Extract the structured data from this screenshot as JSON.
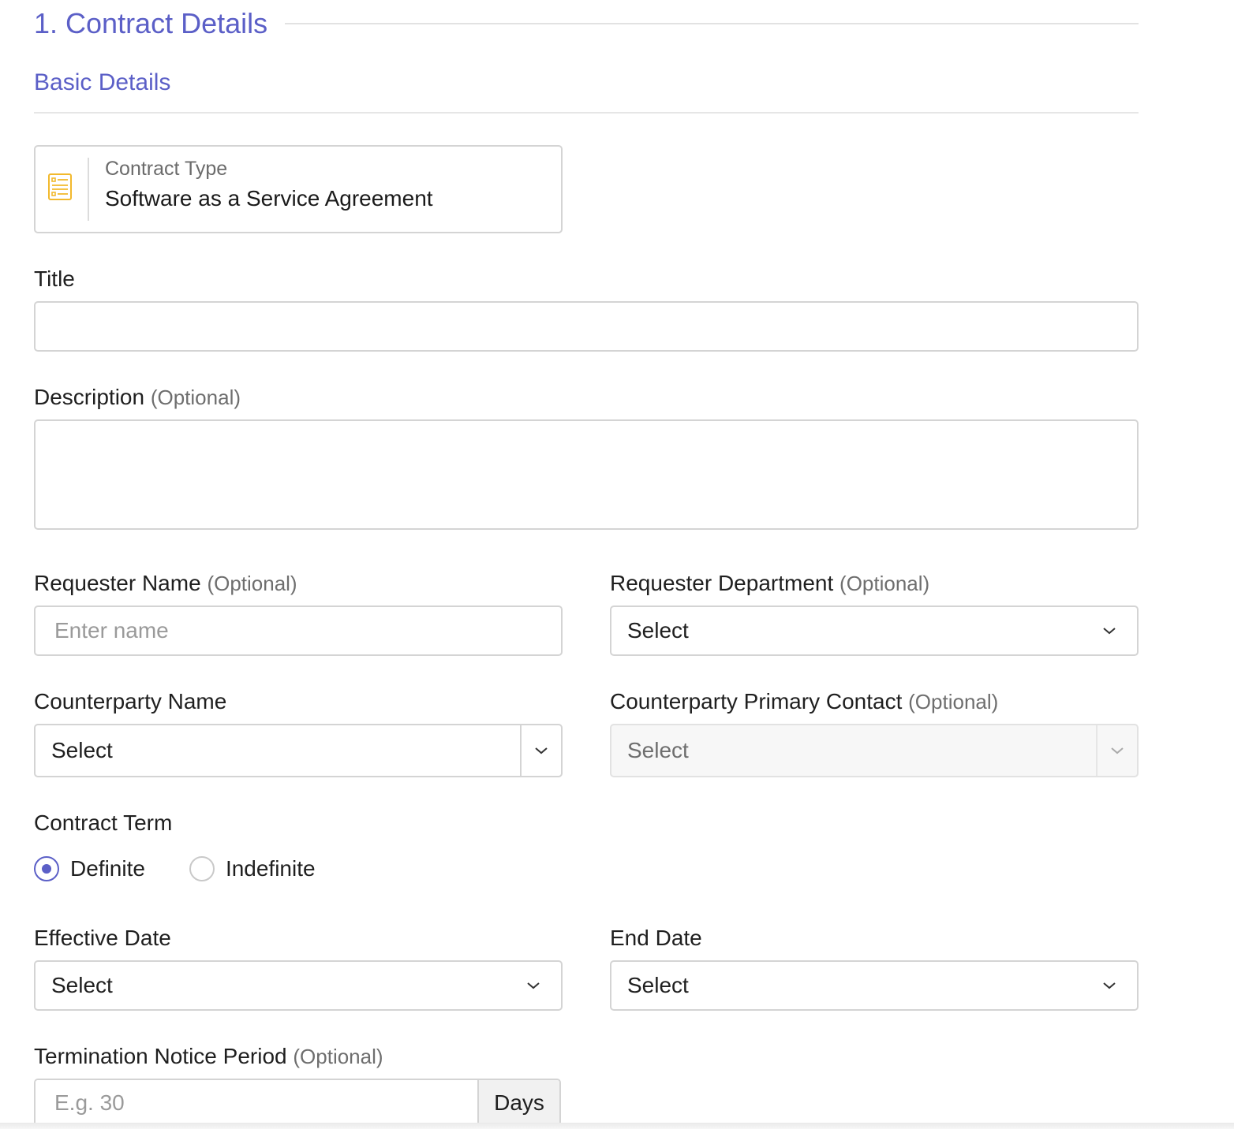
{
  "section": {
    "title": "1. Contract Details"
  },
  "subsection": {
    "title": "Basic Details"
  },
  "contract_type": {
    "label": "Contract Type",
    "value": "Software as a Service Agreement",
    "icon": "document-list-icon"
  },
  "title_field": {
    "label": "Title",
    "value": ""
  },
  "description": {
    "label": "Description",
    "optional": "(Optional)",
    "value": ""
  },
  "requester_name": {
    "label": "Requester Name",
    "optional": "(Optional)",
    "placeholder": "Enter name"
  },
  "requester_department": {
    "label": "Requester Department",
    "optional": "(Optional)",
    "value": "Select"
  },
  "counterparty_name": {
    "label": "Counterparty Name",
    "value": "Select"
  },
  "counterparty_contact": {
    "label": "Counterparty Primary Contact",
    "optional": "(Optional)",
    "value": "Select"
  },
  "contract_term": {
    "label": "Contract Term",
    "options": [
      "Definite",
      "Indefinite"
    ],
    "selected": "Definite"
  },
  "effective_date": {
    "label": "Effective Date",
    "value": "Select"
  },
  "end_date": {
    "label": "End Date",
    "value": "Select"
  },
  "termination_notice": {
    "label": "Termination Notice Period",
    "optional": "(Optional)",
    "placeholder": "E.g. 30",
    "unit": "Days"
  },
  "colors": {
    "accent": "#5b5fc7",
    "icon_yellow": "#f2b92d"
  }
}
